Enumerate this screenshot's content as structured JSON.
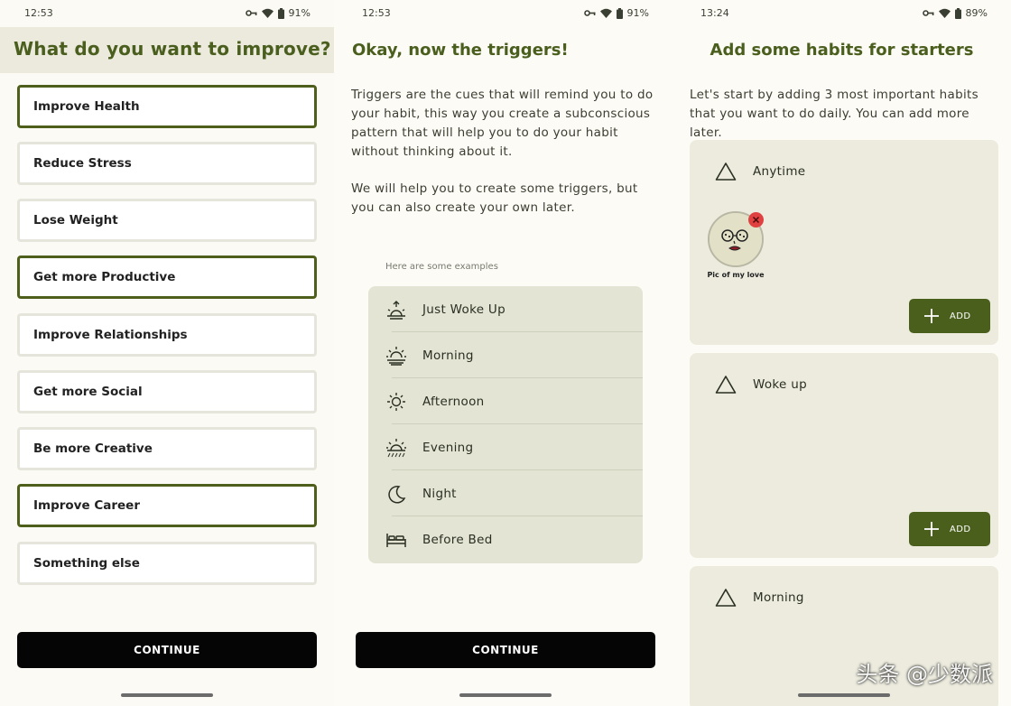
{
  "screen1": {
    "status": {
      "time": "12:53",
      "battery": "91%"
    },
    "title": "What do you want to improve?",
    "options": [
      {
        "label": "Improve Health",
        "selected": true
      },
      {
        "label": "Reduce Stress",
        "selected": false
      },
      {
        "label": "Lose Weight",
        "selected": false
      },
      {
        "label": "Get more Productive",
        "selected": true
      },
      {
        "label": "Improve Relationships",
        "selected": false
      },
      {
        "label": "Get more Social",
        "selected": false
      },
      {
        "label": "Be more Creative",
        "selected": false
      },
      {
        "label": "Improve Career",
        "selected": true
      },
      {
        "label": "Something else",
        "selected": false
      }
    ],
    "continue_label": "CONTINUE"
  },
  "screen2": {
    "status": {
      "time": "12:53",
      "battery": "91%"
    },
    "title": "Okay, now the triggers!",
    "paragraph1": "Triggers are the cues that will remind you to do your habit, this way you create a subconscious pattern that will help you to do your habit without thinking about it.",
    "paragraph2": "We will help you to create some triggers, but you can also create your own later.",
    "examples_label": "Here are some examples",
    "triggers": [
      {
        "label": "Just Woke Up",
        "icon": "sunrise-icon"
      },
      {
        "label": "Morning",
        "icon": "morning-sun-icon"
      },
      {
        "label": "Afternoon",
        "icon": "sun-icon"
      },
      {
        "label": "Evening",
        "icon": "sunset-icon"
      },
      {
        "label": "Night",
        "icon": "moon-icon"
      },
      {
        "label": "Before Bed",
        "icon": "bed-icon"
      }
    ],
    "continue_label": "CONTINUE"
  },
  "screen3": {
    "status": {
      "time": "13:24",
      "battery": "89%"
    },
    "title": "Add some habits for starters",
    "intro": "Let's start by adding 3 most important habits that you want to do daily. You can add more later.",
    "cards": [
      {
        "label": "Anytime",
        "habit_label": "Pic of my love",
        "add_label": "ADD"
      },
      {
        "label": "Woke up",
        "add_label": "ADD"
      },
      {
        "label": "Morning"
      }
    ]
  },
  "watermark": "头条 @少数派",
  "colors": {
    "accent": "#4a5f1c",
    "selected_border": "#4e5f1c",
    "card_bg": "#ecebde",
    "list_bg": "#e3e4d3",
    "danger": "#e04040"
  }
}
